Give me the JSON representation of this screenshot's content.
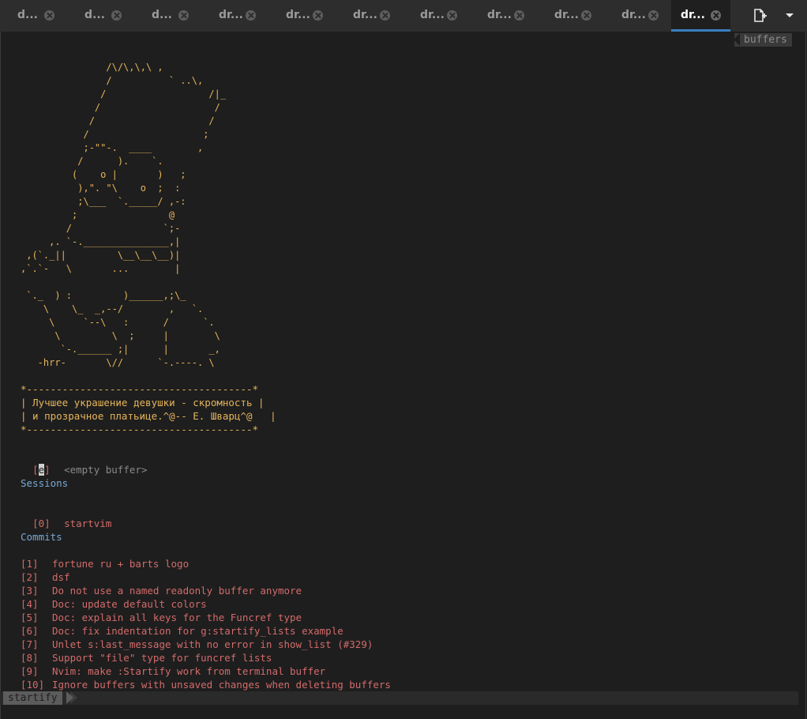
{
  "tabs": [
    {
      "label": "d..."
    },
    {
      "label": "d..."
    },
    {
      "label": "d..."
    },
    {
      "label": "dr..."
    },
    {
      "label": "dr..."
    },
    {
      "label": "dr..."
    },
    {
      "label": "dr..."
    },
    {
      "label": "dr..."
    },
    {
      "label": "dr..."
    },
    {
      "label": "dr..."
    },
    {
      "label": "dr...",
      "active": true
    }
  ],
  "buffers_label": "buffers",
  "ascii_art": "               /\\/\\,\\,\\ ,\n               /          ` ..\\,\n              /                  /|_\n             /                    /\n            /                    /\n           /                    ;\n           ;-\"\"-.  ____        ,\n          /      ).    `.\n         (    o |       )   ;\n          ),\". \"\\    o  ;  :\n          ;\\___  `._____/ ,-:\n         ;                @\n        /                `;-\n     ,. `-._______________,|\n ,(`._||         \\__\\__\\__)|\n,`.`-   \\       ...        |\n\n `._  ) :         )______,;\\_\n    \\    \\_  _,--/        ,   `.\n     \\     `--\\   :      /      `.\n      \\         \\  ;     |        \\\n       `-.______ ;|      |       _,\n   -hrr-       \\//      `-.----. \\",
  "quote": "*--------------------------------------*\n| Лучшее украшение девушки - скромность |\n| и прозрачное платьице.^@-- Е. Шварц^@   |\n*--------------------------------------*",
  "empty_buffer": {
    "key_open": "[",
    "key": "e",
    "key_close": "]",
    "label": "<empty buffer>"
  },
  "sessions_header": "Sessions",
  "sessions": [
    {
      "index": "[0]",
      "label": "startvim"
    }
  ],
  "commits_header": "Commits",
  "commits": [
    {
      "index": "[1]",
      "label": "fortune ru + barts logo"
    },
    {
      "index": "[2]",
      "label": "dsf"
    },
    {
      "index": "[3]",
      "label": "Do not use a named readonly buffer anymore"
    },
    {
      "index": "[4]",
      "label": "Doc: update default colors"
    },
    {
      "index": "[5]",
      "label": "Doc: explain all keys for the Funcref type"
    },
    {
      "index": "[6]",
      "label": "Doc: fix indentation for g:startify_lists example"
    },
    {
      "index": "[7]",
      "label": "Unlet s:last_message with no error in show_list (#329)"
    },
    {
      "index": "[8]",
      "label": "Support \"file\" type for funcref lists"
    },
    {
      "index": "[9]",
      "label": "Nvim: make :Startify work from terminal buffer"
    },
    {
      "index": "[10]",
      "label": "Ignore buffers with unsaved changes when deleting buffers"
    }
  ],
  "status_mode": "startify",
  "colors": {
    "art": "#e6b45a",
    "index": "#d36b6b",
    "header": "#79a9d6",
    "accent": "#3a7fc1"
  }
}
